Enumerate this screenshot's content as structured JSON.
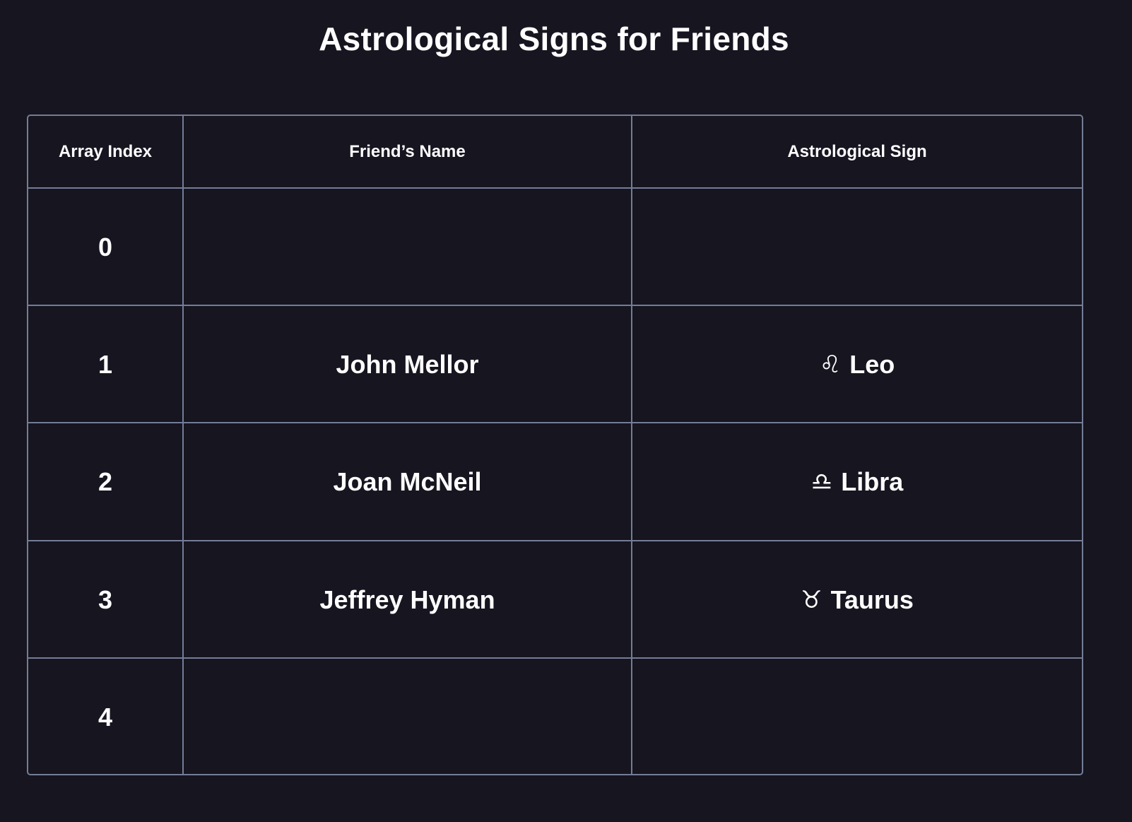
{
  "title": "Astrological Signs for Friends",
  "columns": [
    "Array Index",
    "Friend’s Name",
    "Astrological Sign"
  ],
  "rows": [
    {
      "index": "0",
      "name": "",
      "sign": "",
      "sign_symbol": ""
    },
    {
      "index": "1",
      "name": "John Mellor",
      "sign": "Leo",
      "sign_symbol": "♌︎"
    },
    {
      "index": "2",
      "name": "Joan McNeil",
      "sign": "Libra",
      "sign_symbol": "♎︎"
    },
    {
      "index": "3",
      "name": "Jeffrey Hyman",
      "sign": "Taurus",
      "sign_symbol": "♉︎"
    },
    {
      "index": "4",
      "name": "",
      "sign": "",
      "sign_symbol": ""
    }
  ],
  "colors": {
    "background": "#161520",
    "grid_line": "#747d95",
    "text": "#ffffff"
  }
}
